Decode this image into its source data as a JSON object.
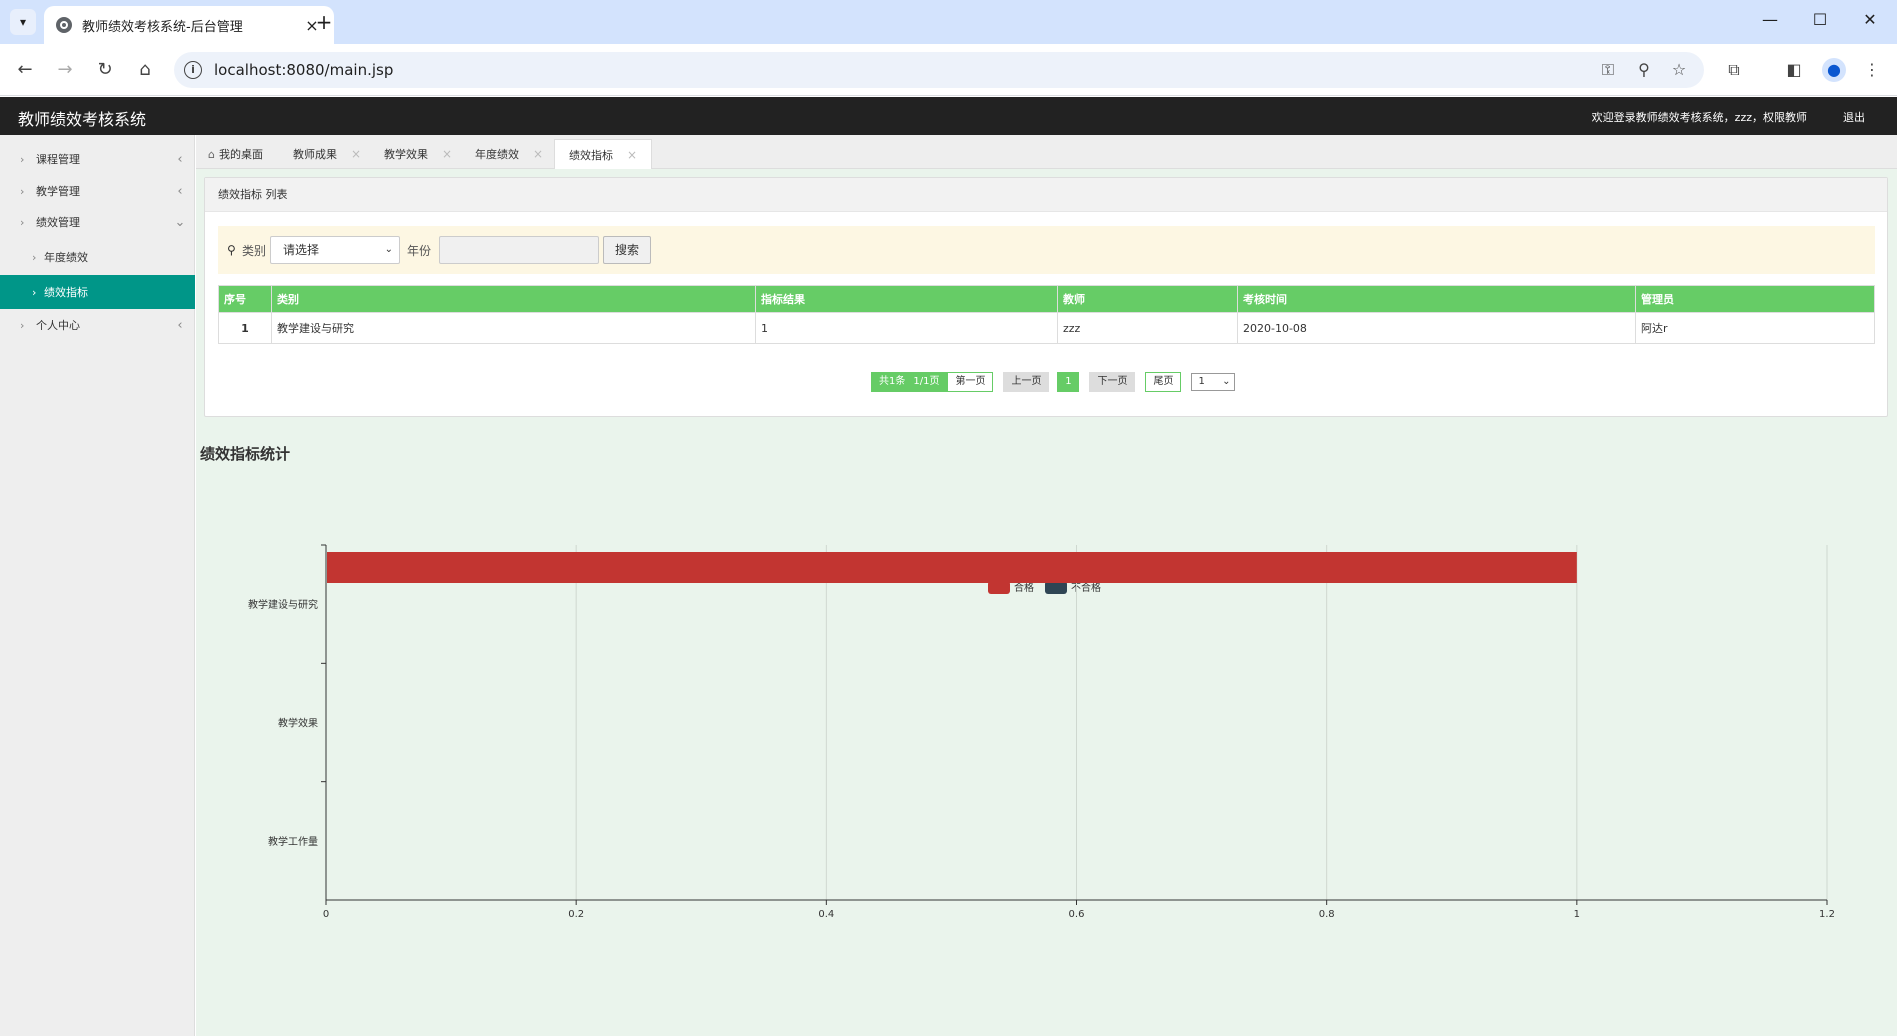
{
  "browser": {
    "tab_title": "教师绩效考核系统-后台管理",
    "url": "localhost:8080/main.jsp"
  },
  "header": {
    "app_title": "教师绩效考核系统",
    "welcome": "欢迎登录教师绩效考核系统，zzz，权限教师",
    "logout": "退出"
  },
  "sidebar": {
    "items": [
      {
        "label": "课程管理"
      },
      {
        "label": "教学管理"
      },
      {
        "label": "绩效管理"
      },
      {
        "label": "年度绩效"
      },
      {
        "label": "绩效指标"
      },
      {
        "label": "个人中心"
      }
    ]
  },
  "page_tabs": [
    {
      "label": "我的桌面"
    },
    {
      "label": "教师成果"
    },
    {
      "label": "教学效果"
    },
    {
      "label": "年度绩效"
    },
    {
      "label": "绩效指标"
    }
  ],
  "panel": {
    "title": "绩效指标 列表",
    "search": {
      "category_label": "类别",
      "category_value": "请选择",
      "year_label": "年份",
      "year_value": "",
      "button": "搜索"
    },
    "table": {
      "headers": [
        "序号",
        "类别",
        "指标结果",
        "教师",
        "考核时间",
        "管理员"
      ],
      "rows": [
        [
          "1",
          "教学建设与研究",
          "1",
          "zzz",
          "2020-10-08",
          "阿达r"
        ]
      ]
    },
    "pager": {
      "total": "共1条",
      "pages": "1/1页",
      "first": "第一页",
      "prev": "上一页",
      "current": "1",
      "next": "下一页",
      "last": "尾页",
      "select_value": "1"
    }
  },
  "stats_title": "绩效指标统计",
  "chart_data": {
    "type": "bar",
    "orientation": "horizontal",
    "categories": [
      "教学建设与研究",
      "教学效果",
      "教学工作量"
    ],
    "series": [
      {
        "name": "合格",
        "values": [
          1,
          0,
          0
        ],
        "color": "#c23531"
      },
      {
        "name": "不合格",
        "values": [
          0,
          0,
          0
        ],
        "color": "#2f4554"
      }
    ],
    "x_ticks": [
      "0",
      "0.2",
      "0.4",
      "0.6",
      "0.8",
      "1",
      "1.2"
    ],
    "xlim": [
      0,
      1.2
    ],
    "legend_position": "top-center",
    "grid": true
  }
}
